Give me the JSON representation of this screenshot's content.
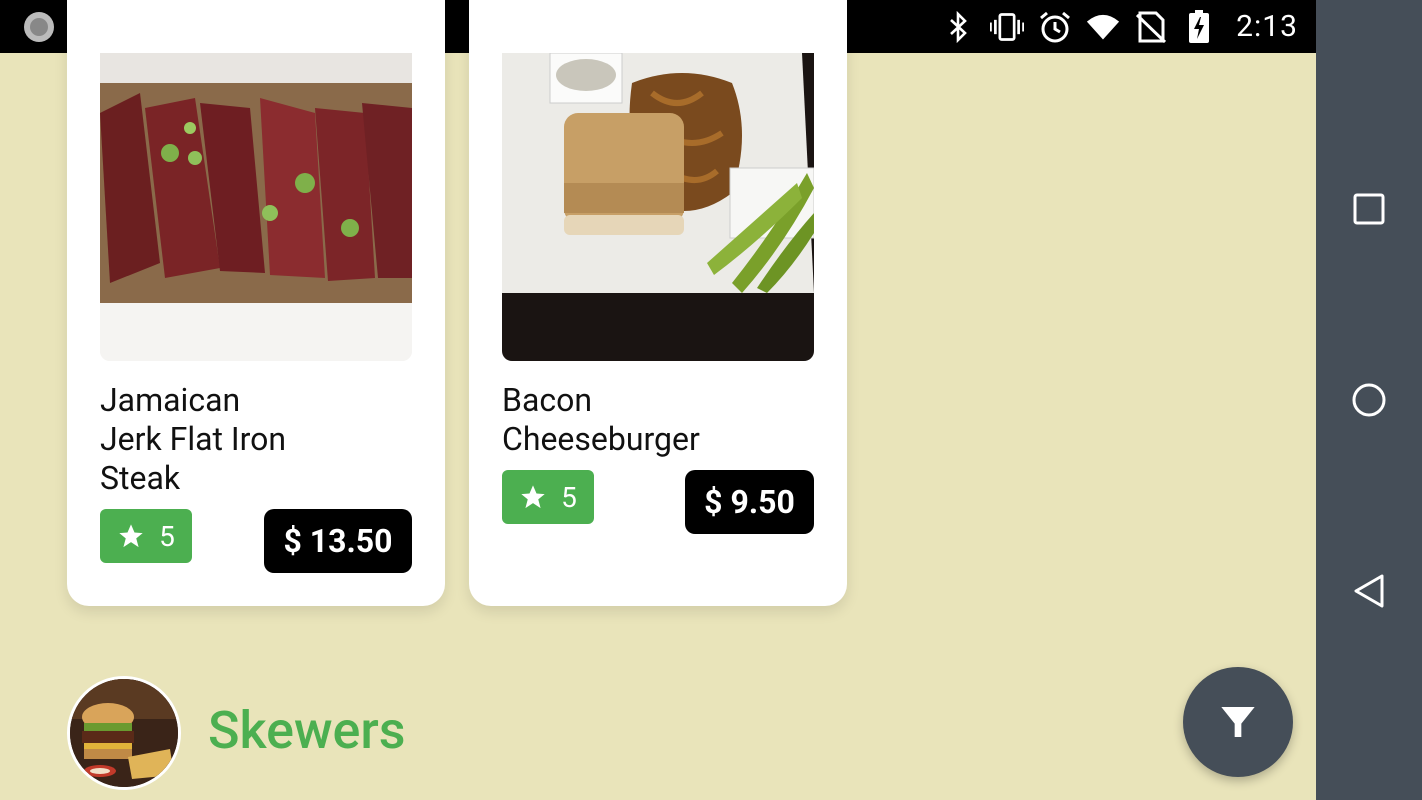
{
  "status_bar": {
    "time": "2:13",
    "icons": [
      "app-notification-icon",
      "activity-monitor-icon",
      "bluetooth-icon",
      "vibrate-icon",
      "alarm-icon",
      "wifi-icon",
      "no-sim-icon",
      "battery-charging-icon"
    ]
  },
  "cards": [
    {
      "title_lines": [
        "Jamaican",
        "Jerk Flat Iron",
        "Steak"
      ],
      "rating": "5",
      "price": "$ 13.50"
    },
    {
      "title_lines": [
        "Bacon",
        "Cheeseburger"
      ],
      "rating": "5",
      "price": "$ 9.50"
    }
  ],
  "category": {
    "label": "Skewers"
  },
  "fab": {
    "icon": "filter-icon"
  },
  "nav_bar": {
    "buttons": [
      "recents-square-icon",
      "home-circle-icon",
      "back-triangle-icon"
    ]
  },
  "colors": {
    "background": "#e9e4ba",
    "accent_green": "#4caf50",
    "nav_gray": "#454e58"
  }
}
